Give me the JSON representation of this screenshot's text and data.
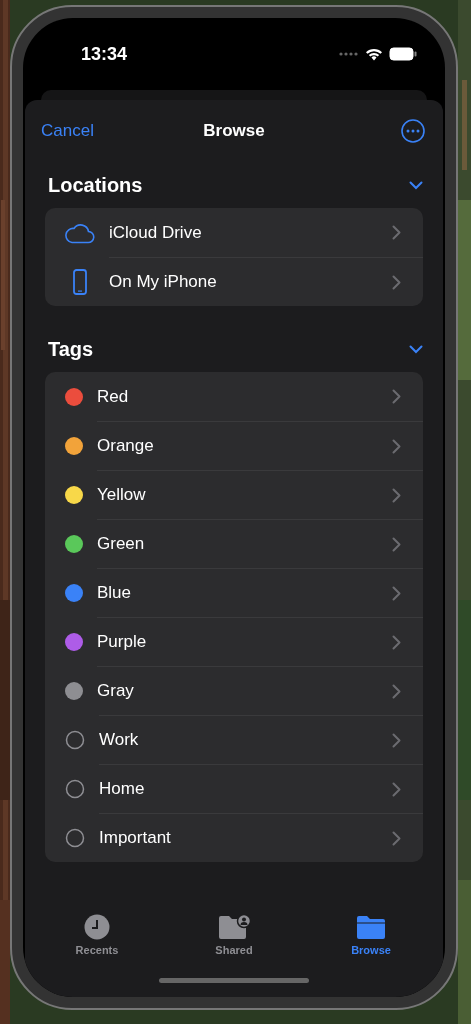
{
  "status_bar": {
    "time": "13:34"
  },
  "nav": {
    "cancel": "Cancel",
    "title": "Browse"
  },
  "locations": {
    "title": "Locations",
    "expanded": true,
    "items": [
      {
        "kind": "cloud",
        "label": "iCloud Drive"
      },
      {
        "kind": "phone",
        "label": "On My iPhone"
      }
    ]
  },
  "tags": {
    "title": "Tags",
    "expanded": true,
    "items": [
      {
        "kind": "filled",
        "label": "Red",
        "color": "#eb4d3d"
      },
      {
        "kind": "filled",
        "label": "Orange",
        "color": "#f2a33a"
      },
      {
        "kind": "filled",
        "label": "Yellow",
        "color": "#f8d849"
      },
      {
        "kind": "filled",
        "label": "Green",
        "color": "#5ac85a"
      },
      {
        "kind": "filled",
        "label": "Blue",
        "color": "#3a82f7"
      },
      {
        "kind": "filled",
        "label": "Purple",
        "color": "#ae5ce8"
      },
      {
        "kind": "filled",
        "label": "Gray",
        "color": "#8e8e92"
      },
      {
        "kind": "outline",
        "label": "Work"
      },
      {
        "kind": "outline",
        "label": "Home"
      },
      {
        "kind": "outline",
        "label": "Important"
      }
    ]
  },
  "tab_bar": [
    {
      "kind": "clock",
      "label": "Recents",
      "selected": false
    },
    {
      "kind": "shared",
      "label": "Shared",
      "selected": false
    },
    {
      "kind": "folder",
      "label": "Browse",
      "selected": true
    }
  ]
}
